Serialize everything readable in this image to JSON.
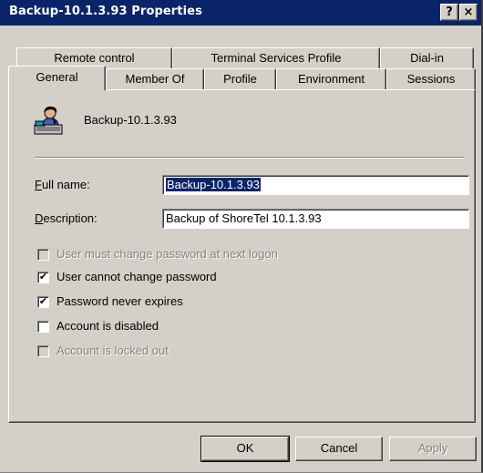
{
  "window": {
    "title": "Backup-10.1.3.93 Properties",
    "help_button": "?",
    "close_button": "×"
  },
  "tabs": {
    "row_back": [
      "Remote control",
      "Terminal Services Profile",
      "Dial-in"
    ],
    "row_front": [
      "General",
      "Member Of",
      "Profile",
      "Environment",
      "Sessions"
    ],
    "active": "General"
  },
  "general": {
    "account_name": "Backup-10.1.3.93",
    "full_name_label": "Full name:",
    "full_name_value": "Backup-10.1.3.93",
    "description_label": "Description:",
    "description_value": "Backup of ShoreTel 10.1.3.93"
  },
  "options": [
    {
      "label": "User must change password at next logon",
      "checked": false,
      "enabled": false
    },
    {
      "label": "User cannot change password",
      "checked": true,
      "enabled": true
    },
    {
      "label": "Password never expires",
      "checked": true,
      "enabled": true
    },
    {
      "label": "Account is disabled",
      "checked": false,
      "enabled": true
    },
    {
      "label": "Account is locked out",
      "checked": false,
      "enabled": false
    }
  ],
  "buttons": {
    "ok": "OK",
    "cancel": "Cancel",
    "apply": "Apply"
  },
  "icons": {
    "user": "user-account-icon",
    "check": "✔"
  },
  "colors": {
    "title_bar": "#0a246a",
    "face": "#d4d0c8",
    "selection": "#0a246a"
  }
}
